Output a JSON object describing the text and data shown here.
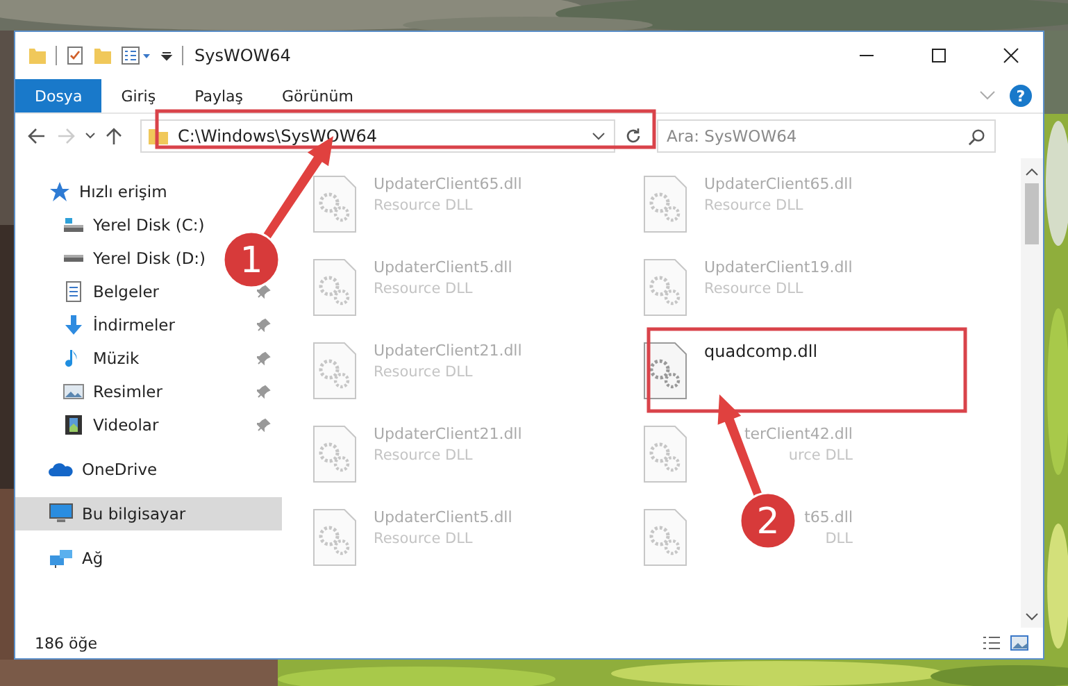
{
  "window": {
    "title": "SysWOW64"
  },
  "ribbon_tabs": [
    {
      "label": "Dosya",
      "selected": true
    },
    {
      "label": "Giriş",
      "selected": false
    },
    {
      "label": "Paylaş",
      "selected": false
    },
    {
      "label": "Görünüm",
      "selected": false
    }
  ],
  "help_button": {
    "label": "?"
  },
  "address_bar": {
    "path": "C:\\Windows\\SysWOW64"
  },
  "search": {
    "placeholder": "Ara: SysWOW64"
  },
  "sidebar": {
    "items": [
      {
        "label": "Hızlı erişim",
        "kind": "star",
        "pinned": false,
        "selected": false
      },
      {
        "label": "Yerel Disk (C:)",
        "kind": "drive",
        "pinned": false,
        "selected": false
      },
      {
        "label": "Yerel Disk (D:)",
        "kind": "drive",
        "pinned": false,
        "selected": false
      },
      {
        "label": "Belgeler",
        "kind": "documents",
        "pinned": true,
        "selected": false
      },
      {
        "label": "İndirmeler",
        "kind": "download",
        "pinned": true,
        "selected": false
      },
      {
        "label": "Müzik",
        "kind": "music",
        "pinned": true,
        "selected": false
      },
      {
        "label": "Resimler",
        "kind": "pictures",
        "pinned": true,
        "selected": false
      },
      {
        "label": "Videolar",
        "kind": "videos",
        "pinned": true,
        "selected": false
      },
      {
        "label": "OneDrive",
        "kind": "cloud",
        "pinned": false,
        "selected": false
      },
      {
        "label": "Bu bilgisayar",
        "kind": "computer",
        "pinned": false,
        "selected": true
      },
      {
        "label": "Ağ",
        "kind": "network",
        "pinned": false,
        "selected": false
      }
    ]
  },
  "files": [
    {
      "name": "UpdaterClient65.dll",
      "type": "Resource DLL",
      "blurred": true
    },
    {
      "name": "UpdaterClient65.dll",
      "type": "Resource DLL",
      "blurred": true
    },
    {
      "name": "UpdaterClient5.dll",
      "type": "Resource DLL",
      "blurred": true
    },
    {
      "name": "UpdaterClient19.dll",
      "type": "Resource DLL",
      "blurred": true
    },
    {
      "name": "UpdaterClient21.dll",
      "type": "Resource DLL",
      "blurred": true
    },
    {
      "name": "quadcomp.dll",
      "blurred": false
    },
    {
      "name": "UpdaterClient21.dll",
      "type": "Resource DLL",
      "blurred": true
    },
    {
      "name": "terClient42.dll",
      "type": "urce DLL",
      "blurred": true,
      "partly_covered": true
    },
    {
      "name": "UpdaterClient5.dll",
      "type": "Resource DLL",
      "blurred": true
    },
    {
      "name": "t65.dll",
      "type": "DLL",
      "blurred": true,
      "partly_covered": true
    }
  ],
  "status_bar": {
    "count": "186 öğe"
  },
  "annotations": [
    {
      "number": "1"
    },
    {
      "number": "2"
    }
  ]
}
